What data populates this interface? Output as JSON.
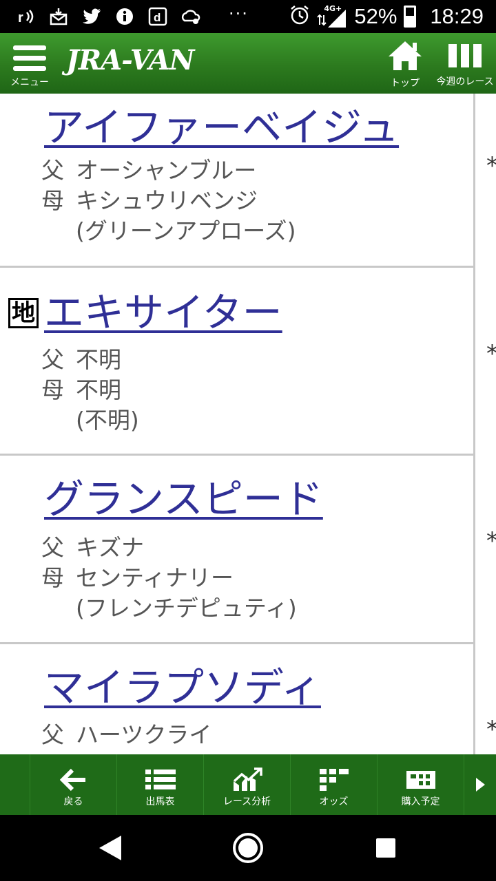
{
  "status_bar": {
    "icons": [
      "signal-r-icon",
      "download-mail-icon",
      "twitter-icon",
      "info-icon",
      "docomo-d-icon",
      "settings-cloud-icon"
    ],
    "dots": "···",
    "network": "4G+",
    "battery": "52%",
    "battery_level": 0.52,
    "time": "18:29"
  },
  "header": {
    "menu_label": "メニュー",
    "logo": "JRA-VAN",
    "top_label": "トップ",
    "week_label": "今週のレース",
    "brand_color": "#2c7a1e"
  },
  "horses": [
    {
      "name": "アイファーベイジュ",
      "sire_key": "父",
      "sire": "オーシャンブルー",
      "dam_key": "母",
      "dam": "キシュウリベンジ",
      "dam_sire": "(グリーンアプローズ)",
      "mark": "",
      "star": "*"
    },
    {
      "name": "エキサイター",
      "sire_key": "父",
      "sire": "不明",
      "dam_key": "母",
      "dam": "不明",
      "dam_sire": "(不明)",
      "mark": "地",
      "star": "*"
    },
    {
      "name": "グランスピード",
      "sire_key": "父",
      "sire": "キズナ",
      "dam_key": "母",
      "dam": "センティナリー",
      "dam_sire": "(フレンチデピュティ)",
      "mark": "",
      "star": "*"
    },
    {
      "name": "マイラプソディ",
      "sire_key": "父",
      "sire": "ハーツクライ",
      "dam_key": "母",
      "dam": "",
      "dam_sire": "",
      "mark": "",
      "star": "*"
    }
  ],
  "bottom_nav": {
    "back": "戻る",
    "entries": "出馬表",
    "analysis": "レース分析",
    "odds": "オッズ",
    "purchase": "購入予定"
  }
}
